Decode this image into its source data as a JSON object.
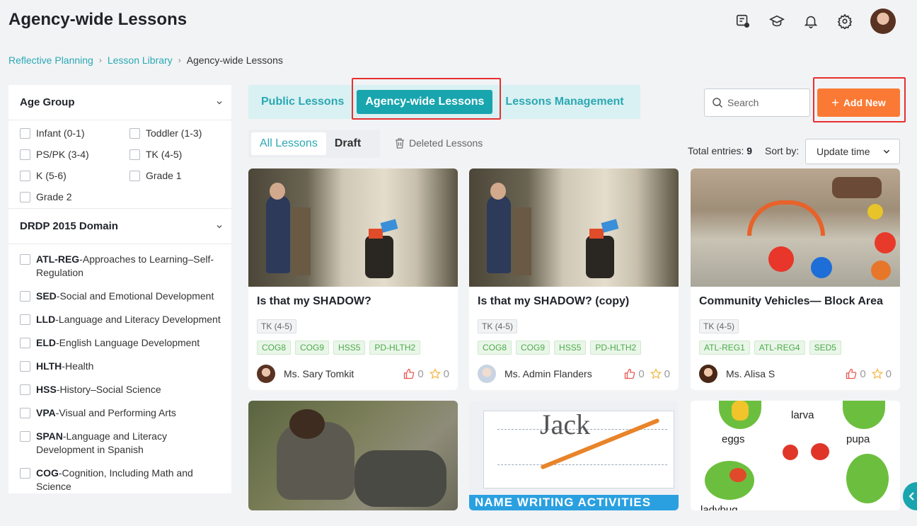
{
  "header": {
    "title": "Agency-wide Lessons",
    "icons": [
      "chat-icon",
      "graduation-cap-icon",
      "bell-icon",
      "gear-icon",
      "avatar"
    ]
  },
  "breadcrumb": {
    "items": [
      "Reflective Planning",
      "Lesson Library"
    ],
    "current": "Agency-wide Lessons"
  },
  "sidebar": {
    "age_group": {
      "title": "Age Group",
      "options": [
        "Infant (0-1)",
        "Toddler (1-3)",
        "PS/PK (3-4)",
        "TK (4-5)",
        "K (5-6)",
        "Grade 1",
        "Grade 2"
      ]
    },
    "domain": {
      "title": "DRDP 2015 Domain",
      "items": [
        {
          "code": "ATL-REG",
          "label": "-Approaches to Learning–Self-Regulation"
        },
        {
          "code": "SED",
          "label": "-Social and Emotional Development"
        },
        {
          "code": "LLD",
          "label": "-Language and Literacy Development"
        },
        {
          "code": "ELD",
          "label": "-English Language Development"
        },
        {
          "code": "HLTH",
          "label": "-Health"
        },
        {
          "code": "HSS",
          "label": "-History–Social Science"
        },
        {
          "code": "VPA",
          "label": "-Visual and Performing Arts"
        },
        {
          "code": "SPAN",
          "label": "-Language and Literacy Development in Spanish"
        },
        {
          "code": "COG",
          "label": "-Cognition, Including Math and Science"
        }
      ]
    }
  },
  "tabs": {
    "public": "Public Lessons",
    "agency": "Agency-wide Lessons",
    "management": "Lessons Management"
  },
  "search": {
    "placeholder": "Search"
  },
  "add_button": "Add New",
  "subtabs": {
    "all": "All Lessons",
    "draft": "Draft",
    "deleted": "Deleted Lessons"
  },
  "toolbar": {
    "total_label": "Total entries:",
    "total_value": "9",
    "sort_label": "Sort by:",
    "sort_value": "Update time"
  },
  "cards": [
    {
      "title": "Is that my SHADOW?",
      "age": "TK (4-5)",
      "tags": [
        "COG8",
        "COG9",
        "HSS5",
        "PD-HLTH2"
      ],
      "author": "Ms. Sary Tomkit",
      "likes": "0",
      "stars": "0"
    },
    {
      "title": "Is that my SHADOW? (copy)",
      "age": "TK (4-5)",
      "tags": [
        "COG8",
        "COG9",
        "HSS5",
        "PD-HLTH2"
      ],
      "author": "Ms. Admin Flanders",
      "likes": "0",
      "stars": "0"
    },
    {
      "title": "Community Vehicles— Block Area",
      "age": "TK (4-5)",
      "tags": [
        "ATL-REG1",
        "ATL-REG4",
        "SED5"
      ],
      "author": "Ms. Alisa S",
      "likes": "0",
      "stars": "0"
    }
  ],
  "bottom_cards": {
    "card5_text": "NAME WRITING ACTIVITIES",
    "card5_name": "Jack",
    "card6_labels": [
      "larva",
      "eggs",
      "pupa",
      "ladybug"
    ]
  },
  "colors": {
    "accent": "#19a5ae",
    "orange": "#fa7a35",
    "highlight": "#e8302f"
  }
}
